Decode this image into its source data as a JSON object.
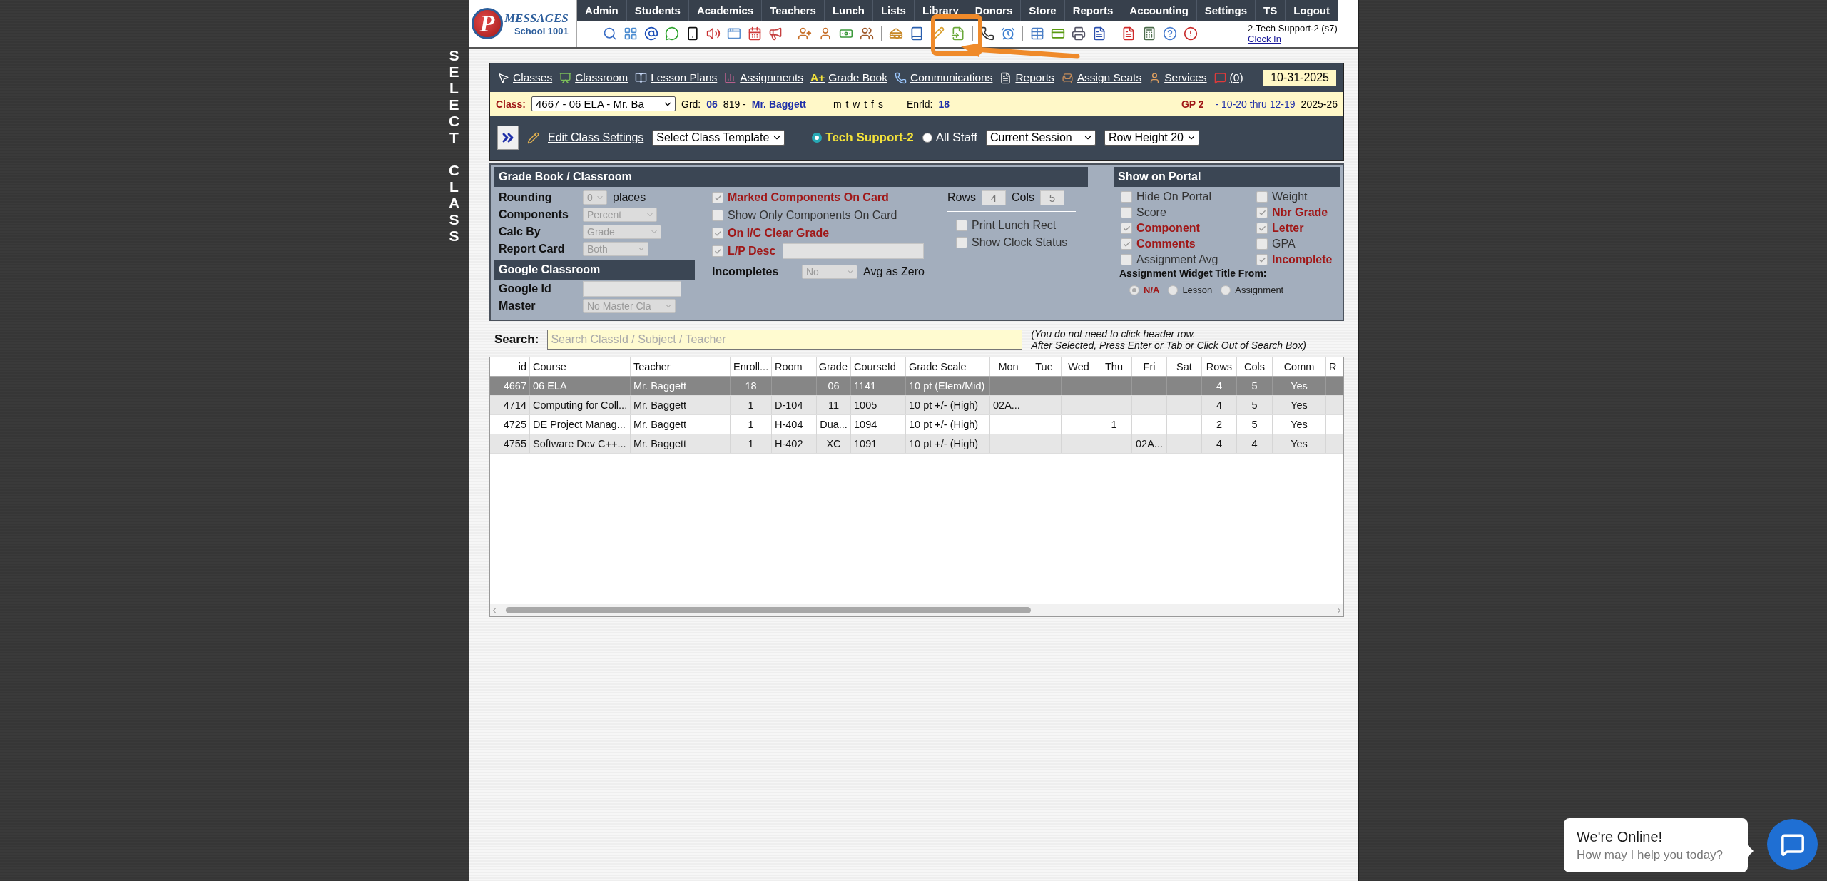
{
  "side_label": [
    "SELECT",
    "CLASS"
  ],
  "logo": {
    "mark": "P",
    "brand": "MESSAGES",
    "school": "School 1001"
  },
  "menu": [
    "Admin",
    "Students",
    "Academics",
    "Teachers",
    "Lunch",
    "Lists",
    "Library",
    "Donors",
    "Store",
    "Reports",
    "Accounting",
    "Settings",
    "TS",
    "Logout"
  ],
  "user": {
    "name": "2-Tech Support-2 (s7)",
    "link": "Clock In"
  },
  "nav_links": [
    {
      "label": "Classes"
    },
    {
      "label": "Classroom"
    },
    {
      "label": "Lesson Plans"
    },
    {
      "label": "Assignments"
    },
    {
      "label": "Grade Book",
      "mark": "A+"
    },
    {
      "label": "Communications"
    },
    {
      "label": "Reports"
    },
    {
      "label": "Assign Seats"
    },
    {
      "label": "Services"
    },
    {
      "label": "(0)"
    }
  ],
  "date": "10-31-2025",
  "class_row": {
    "label": "Class:",
    "class_select": "4667 - 06 ELA - Mr. Ba",
    "grd_label": "Grd:",
    "grd": "06",
    "teacher_id": "819 -",
    "teacher": "Mr. Baggett",
    "days": "m t w t f s",
    "enrld_label": "Enrld:",
    "enrld": "18",
    "gp": "GP 2",
    "range": "- 10-20 thru 12-19",
    "year": "2025-26"
  },
  "settings_bar": {
    "edit": "Edit Class Settings",
    "template": "Select Class Template",
    "staff_options": [
      {
        "label": "Tech Support-2",
        "selected": true
      },
      {
        "label": "All Staff",
        "selected": false
      }
    ],
    "session": "Current Session",
    "row_height": "Row Height 20"
  },
  "gradebook": {
    "title": "Grade Book / Classroom",
    "fields": [
      {
        "label": "Rounding",
        "value": "0",
        "suffix": "places"
      },
      {
        "label": "Components",
        "value": "Percent"
      },
      {
        "label": "Calc By",
        "value": "Grade"
      },
      {
        "label": "Report Card",
        "value": "Both"
      }
    ]
  },
  "google": {
    "title": "Google Classroom",
    "fields": [
      {
        "label": "Google Id",
        "kind": "input"
      },
      {
        "label": "Master",
        "kind": "select",
        "value": "No Master Cla"
      }
    ]
  },
  "card_options": [
    {
      "label": "Marked Components On Card",
      "checked": true,
      "kind": "plain"
    },
    {
      "label": "Show Only Components On Card",
      "checked": false,
      "kind": "plain"
    },
    {
      "label": "On I/C Clear Grade",
      "checked": true,
      "kind": "plain"
    },
    {
      "label": "L/P Desc",
      "checked": true,
      "kind": "with-input"
    }
  ],
  "incompletes": {
    "label": "Incompletes",
    "value": "No",
    "suffix": "Avg as Zero"
  },
  "grid_size": {
    "rows_label": "Rows",
    "rows": "4",
    "cols_label": "Cols",
    "cols": "5"
  },
  "print_options": [
    {
      "label": "Print Lunch Rect",
      "checked": false
    },
    {
      "label": "Show Clock Status",
      "checked": false
    }
  ],
  "portal": {
    "title": "Show on Portal",
    "options": [
      {
        "label": "Hide On Portal",
        "checked": false
      },
      {
        "label": "Weight",
        "checked": false
      },
      {
        "label": "Score",
        "checked": false
      },
      {
        "label": "Nbr Grade",
        "checked": true
      },
      {
        "label": "Component",
        "checked": true
      },
      {
        "label": "Letter",
        "checked": true
      },
      {
        "label": "Comments",
        "checked": true
      },
      {
        "label": "GPA",
        "checked": false
      },
      {
        "label": "Assignment Avg",
        "checked": false
      },
      {
        "label": "Incomplete",
        "checked": true
      }
    ],
    "widget_title": "Assignment Widget Title From:",
    "widget_options": [
      {
        "label": "N/A",
        "selected": true
      },
      {
        "label": "Lesson",
        "selected": false
      },
      {
        "label": "Assignment",
        "selected": false
      }
    ]
  },
  "search": {
    "label": "Search:",
    "placeholder": "Search ClassId / Subject / Teacher",
    "hint": [
      "(You do not need to click header row.",
      "After Selected, Press Enter or Tab or Click Out of Search Box)"
    ]
  },
  "table": {
    "columns": [
      "id",
      "Course",
      "Teacher",
      "Enroll...",
      "Room",
      "Grade",
      "CourseId",
      "Grade Scale",
      "Mon",
      "Tue",
      "Wed",
      "Thu",
      "Fri",
      "Sat",
      "Rows",
      "Cols",
      "Comm",
      "R"
    ],
    "rows": [
      {
        "selected": true,
        "cells": [
          "4667",
          "06 ELA",
          "Mr. Baggett",
          "18",
          null,
          "06",
          "1141",
          "10 pt (Elem/Mid)",
          null,
          null,
          null,
          null,
          null,
          null,
          "4",
          "5",
          "Yes",
          null
        ]
      },
      {
        "selected": false,
        "cells": [
          "4714",
          "Computing for Coll...",
          "Mr. Baggett",
          "1",
          "D-104",
          "11",
          "1005",
          "10 pt +/- (High)",
          "02A...",
          null,
          null,
          null,
          null,
          null,
          "4",
          "5",
          "Yes",
          null
        ]
      },
      {
        "selected": false,
        "cells": [
          "4725",
          "DE Project Manag...",
          "Mr. Baggett",
          "1",
          "H-404",
          "Dua...",
          "1094",
          "10 pt +/- (High)",
          null,
          null,
          null,
          "1",
          null,
          null,
          "2",
          "5",
          "Yes",
          null
        ]
      },
      {
        "selected": false,
        "cells": [
          "4755",
          "Software Dev C++...",
          "Mr. Baggett",
          "1",
          "H-402",
          "XC",
          "1091",
          "10 pt +/- (High)",
          null,
          null,
          null,
          null,
          "02A...",
          null,
          "4",
          "4",
          "Yes",
          null
        ]
      }
    ]
  },
  "chat": {
    "title": "We're Online!",
    "subtitle": "How may I help you today?"
  }
}
